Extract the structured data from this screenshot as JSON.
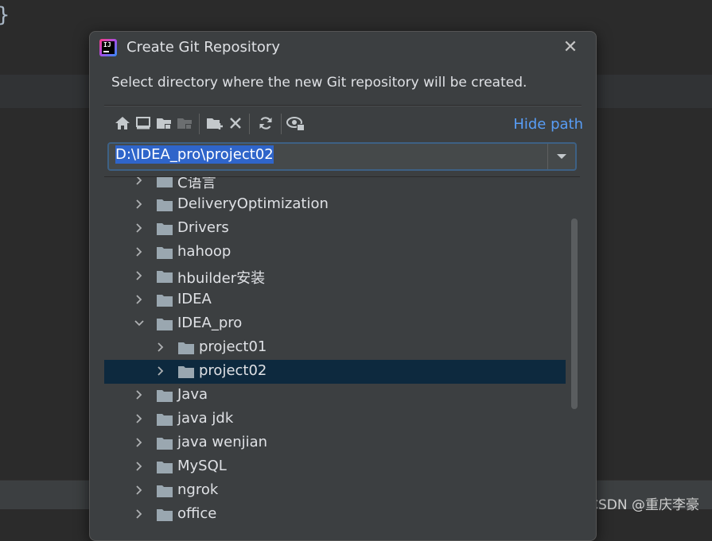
{
  "background": {
    "brace": "}"
  },
  "watermark": "CSDN @重庆李豪",
  "dialog": {
    "title": "Create Git Repository",
    "instruction": "Select directory where the new Git repository will be created.",
    "hide_path_label": "Hide path",
    "path_value": "D:\\IDEA_pro\\project02",
    "toolbar": [
      "home-icon",
      "desktop-icon",
      "project-folder-icon",
      "module-folder-icon",
      "new-folder-icon",
      "delete-icon",
      "refresh-icon",
      "show-hidden-icon"
    ],
    "tree": [
      {
        "label": "C语言",
        "expanded": false,
        "level": 0,
        "selected": false
      },
      {
        "label": "DeliveryOptimization",
        "expanded": false,
        "level": 0,
        "selected": false
      },
      {
        "label": "Drivers",
        "expanded": false,
        "level": 0,
        "selected": false
      },
      {
        "label": "hahoop",
        "expanded": false,
        "level": 0,
        "selected": false
      },
      {
        "label": "hbuilder安装",
        "expanded": false,
        "level": 0,
        "selected": false
      },
      {
        "label": "IDEA",
        "expanded": false,
        "level": 0,
        "selected": false
      },
      {
        "label": "IDEA_pro",
        "expanded": true,
        "level": 0,
        "selected": false
      },
      {
        "label": "project01",
        "expanded": false,
        "level": 1,
        "selected": false
      },
      {
        "label": "project02",
        "expanded": false,
        "level": 1,
        "selected": true
      },
      {
        "label": "Java",
        "expanded": false,
        "level": 0,
        "selected": false
      },
      {
        "label": "java jdk",
        "expanded": false,
        "level": 0,
        "selected": false
      },
      {
        "label": "java wenjian",
        "expanded": false,
        "level": 0,
        "selected": false
      },
      {
        "label": "MySQL",
        "expanded": false,
        "level": 0,
        "selected": false
      },
      {
        "label": "ngrok",
        "expanded": false,
        "level": 0,
        "selected": false
      },
      {
        "label": "office",
        "expanded": false,
        "level": 0,
        "selected": false
      }
    ]
  },
  "colors": {
    "accent": "#589df6",
    "selection": "#0d293e",
    "folder": "#9aa7b0",
    "text": "#dfe1e5"
  }
}
